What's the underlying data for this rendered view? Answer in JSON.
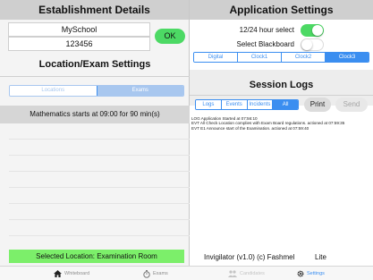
{
  "establishment": {
    "header": "Establishment Details",
    "school_name": "MySchool",
    "center_number": "123456",
    "ok_label": "OK"
  },
  "location_settings": {
    "title": "Location/Exam Settings",
    "segments": [
      "Locations",
      "Exams"
    ],
    "selected_segment": "Exams",
    "exam_row": "Mathematics starts at 09:00 for 90 min(s)",
    "selected_location": "Selected Location: Examination Room"
  },
  "app_settings": {
    "header": "Application Settings",
    "hour_toggle_label": "12/24 hour select",
    "hour_toggle_on": true,
    "blackboard_toggle_label": "Select Blackboard",
    "blackboard_toggle_on": false,
    "clock_segments": [
      "Digital",
      "Clock1",
      "Clock2",
      "Clock3"
    ],
    "selected_clock": "Clock3"
  },
  "session_logs": {
    "title": "Session Logs",
    "tabs": [
      "Logs",
      "Events",
      "Incidents",
      "All"
    ],
    "selected_tab": "All",
    "print_label": "Print",
    "send_label": "Send",
    "entries": [
      "LOG Application Started at 07:56:10",
      "EVT All Check Location complies with Exam Board regulations. actioned at 07:59:35",
      "EVT E1 Announce start of the Examination. actioned at 07:59:40"
    ]
  },
  "footer": {
    "version": "Invigilator (v1.0) (c) Fashmel",
    "edition": "Lite"
  },
  "tabbar": {
    "items": [
      {
        "label": "Whiteboard",
        "icon": "house-icon"
      },
      {
        "label": "Exams",
        "icon": "stopwatch-icon"
      },
      {
        "label": "Candidates",
        "icon": "people-icon"
      },
      {
        "label": "Settings",
        "icon": "gear-icon"
      }
    ],
    "active": "Settings"
  },
  "colors": {
    "accent": "#3b8ef0",
    "green": "#4cd964",
    "location_bar": "#7cef6a"
  }
}
